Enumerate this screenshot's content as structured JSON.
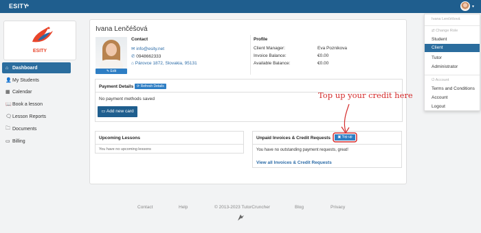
{
  "topbar": {
    "brand": "ESITY",
    "caret": "▾",
    "user_caret": "▾"
  },
  "logo": {
    "text": "ESITY"
  },
  "sidebar": {
    "items": [
      {
        "icon": "⌂",
        "label": "Dashboard",
        "active": true
      },
      {
        "icon": "👤",
        "label": "My Students"
      },
      {
        "icon": "▦",
        "label": "Calendar"
      },
      {
        "icon": "📖",
        "label": "Book a lesson"
      },
      {
        "icon": "🗨",
        "label": "Lesson Reports"
      },
      {
        "icon": "🗀",
        "label": "Documents"
      },
      {
        "icon": "▭",
        "label": "Billing"
      }
    ]
  },
  "profile": {
    "name": "Ivana Lenčéšová",
    "edit_label": "Edit",
    "contact_heading": "Contact",
    "email": "info@esity.net",
    "phone": "0948662333",
    "address": "Párovce 1872, Slovakia, 95131",
    "profile_heading": "Profile",
    "rows": [
      {
        "label": "Client Manager:",
        "value": "Eva Poznikova"
      },
      {
        "label": "Invoice Balance:",
        "value": "€0.00"
      },
      {
        "label": "Available Balance:",
        "value": "€0.00"
      }
    ]
  },
  "payment": {
    "heading": "Payment Details",
    "refresh_label": "Refresh Details",
    "message": "No payment methods saved",
    "add_card_label": "Add new card"
  },
  "lessons": {
    "heading": "Upcoming Lessons",
    "message": "You have no upcoming lessons"
  },
  "invoices": {
    "heading": "Unpaid Invoices & Credit Requests",
    "topup_label": "Top up",
    "message": "You have no outstanding payment requests, great!",
    "view_all": "View all Invoices & Credit Requests"
  },
  "annotation": {
    "callout": "Top up your credit here",
    "color": "#d42a2a"
  },
  "dropdown": {
    "user_name": "Ivana Lenčéšová",
    "change_role": "Change Role",
    "roles": [
      "Student",
      "Client",
      "Tutor",
      "Administrator"
    ],
    "selected_role": "Client",
    "account_heading": "Account",
    "account_items": [
      "Terms and Conditions",
      "Account",
      "Logout"
    ]
  },
  "footer": {
    "contact": "Contact",
    "help": "Help",
    "copyright": "© 2013-2023 TutorCruncher",
    "blog": "Blog",
    "privacy": "Privacy"
  },
  "colors": {
    "topbar": "#1f5e8e",
    "primary": "#2e7ec4",
    "active_nav": "#2b6d9e",
    "brand_logo": "#e8452b"
  }
}
